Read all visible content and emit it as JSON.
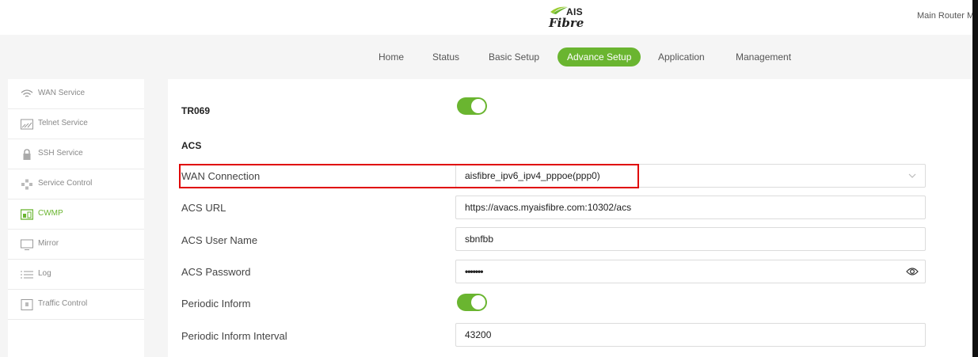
{
  "header": {
    "logo_top": "AIS",
    "logo_bottom": "Fibre",
    "router_name": "Main Router M"
  },
  "nav": {
    "items": [
      {
        "label": "Home"
      },
      {
        "label": "Status"
      },
      {
        "label": "Basic Setup"
      },
      {
        "label": "Advance Setup",
        "active": true
      },
      {
        "label": "Application"
      },
      {
        "label": "Management"
      }
    ]
  },
  "sidebar": {
    "items": [
      {
        "label": "WAN Service",
        "icon": "wifi-icon"
      },
      {
        "label": "Telnet Service",
        "icon": "terminal-icon"
      },
      {
        "label": "SSH Service",
        "icon": "lock-icon"
      },
      {
        "label": "Service Control",
        "icon": "network-icon"
      },
      {
        "label": "CWMP",
        "icon": "cwmp-icon",
        "active": true
      },
      {
        "label": "Mirror",
        "icon": "monitor-icon"
      },
      {
        "label": "Log",
        "icon": "list-icon"
      },
      {
        "label": "Traffic Control",
        "icon": "traffic-icon"
      }
    ]
  },
  "form": {
    "tr069_label": "TR069",
    "tr069_enabled": true,
    "acs_heading": "ACS",
    "wan_connection_label": "WAN Connection",
    "wan_connection_value": "aisfibre_ipv6_ipv4_pppoe(ppp0)",
    "acs_url_label": "ACS URL",
    "acs_url_value": "https://avacs.myaisfibre.com:10302/acs",
    "acs_user_label": "ACS User Name",
    "acs_user_value": "sbnfbb",
    "acs_password_label": "ACS Password",
    "acs_password_value": "•••••••",
    "periodic_inform_label": "Periodic Inform",
    "periodic_inform_enabled": true,
    "periodic_interval_label": "Periodic Inform Interval",
    "periodic_interval_value": "43200"
  },
  "colors": {
    "accent": "#6ab530",
    "highlight": "#e00000"
  }
}
